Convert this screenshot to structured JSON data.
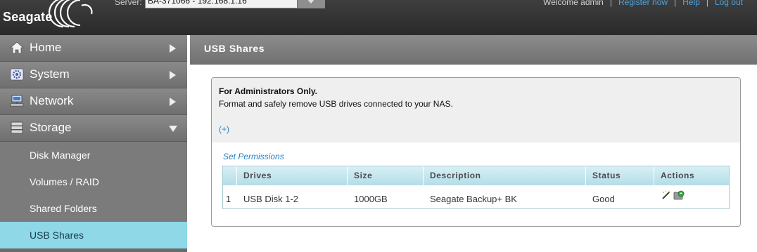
{
  "header": {
    "brand": "Seagate",
    "server_label": "Server:",
    "server_value": "BA-371066 - 192.168.1.16",
    "welcome": "Welcome admin",
    "register_link": "Register now",
    "help_link": "Help",
    "logout_link": "Log out",
    "separator": "|"
  },
  "sidebar": {
    "items": [
      {
        "label": "Home",
        "icon": "home-icon"
      },
      {
        "label": "System",
        "icon": "gear-icon"
      },
      {
        "label": "Network",
        "icon": "network-icon"
      },
      {
        "label": "Storage",
        "icon": "storage-icon"
      }
    ],
    "storage_subitems": [
      {
        "label": "Disk Manager"
      },
      {
        "label": "Volumes / RAID"
      },
      {
        "label": "Shared Folders"
      },
      {
        "label": "USB Shares",
        "active": true
      }
    ]
  },
  "page": {
    "title": "USB Shares",
    "admin_title": "For Administrators Only.",
    "admin_desc": "Format and safely remove USB drives connected to your NAS.",
    "expand_link": "(+)",
    "set_permissions": "Set Permissions"
  },
  "table": {
    "columns": [
      "Drives",
      "Size",
      "Description",
      "Status",
      "Actions"
    ],
    "rows": [
      {
        "index": "1",
        "drive": "USB Disk 1-2",
        "size": "1000GB",
        "description": "Seagate Backup+ BK",
        "status": "Good",
        "actions": [
          "edit-icon",
          "eject-icon"
        ]
      }
    ]
  },
  "colors": {
    "header_bg": "#2f2f2f",
    "sidebar_bg": "#7b7b7b",
    "active_item": "#8ed8e8",
    "link": "#2a7fc0",
    "table_header": "#c4e6ee"
  }
}
